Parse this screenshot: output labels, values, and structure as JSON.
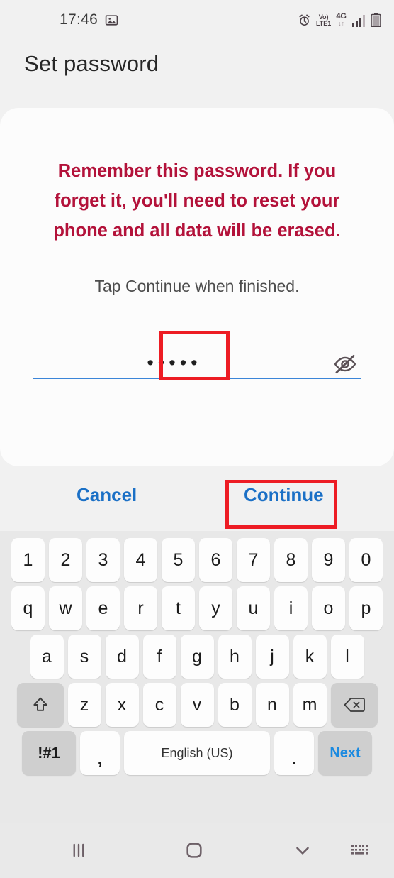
{
  "status_bar": {
    "time": "17:46",
    "left_icons": [
      "image-icon"
    ],
    "right_icons": [
      "alarm-icon",
      "volte-icon",
      "network-4g-icon",
      "signal-bars-icon",
      "battery-icon"
    ],
    "volte_top": "Vo)",
    "volte_bottom": "LTE1",
    "network_label": "4G",
    "network_arrows": "↓↑"
  },
  "header": {
    "title": "Set password"
  },
  "card": {
    "warning": "Remember this password. If you forget it, you'll need to reset your phone and all data will be erased.",
    "hint": "Tap Continue when finished.",
    "password_field": {
      "value": "•••••",
      "character_count": 5,
      "masked": true,
      "toggle_icon": "eye-slash-icon"
    }
  },
  "actions": {
    "cancel_label": "Cancel",
    "continue_label": "Continue"
  },
  "annotations": [
    {
      "name": "password-field-highlight",
      "color": "#ed1c24"
    },
    {
      "name": "continue-button-highlight",
      "color": "#ed1c24"
    }
  ],
  "keyboard": {
    "language": "English (US)",
    "row_numbers": [
      "1",
      "2",
      "3",
      "4",
      "5",
      "6",
      "7",
      "8",
      "9",
      "0"
    ],
    "row_top": [
      "q",
      "w",
      "e",
      "r",
      "t",
      "y",
      "u",
      "i",
      "o",
      "p"
    ],
    "row_home": [
      "a",
      "s",
      "d",
      "f",
      "g",
      "h",
      "j",
      "k",
      "l"
    ],
    "row_bottom": [
      "z",
      "x",
      "c",
      "v",
      "b",
      "n",
      "m"
    ],
    "shift_icon": "shift-arrow-icon",
    "backspace_icon": "backspace-icon",
    "symbols_label": "!#1",
    "comma_label": ",",
    "period_label": ".",
    "next_label": "Next"
  },
  "nav_bar": {
    "recents_icon": "recents-icon",
    "home_icon": "home-icon",
    "back_icon": "chevron-down-icon",
    "keyboard_switch_icon": "keyboard-switch-icon"
  },
  "colors": {
    "warning_red": "#b3123a",
    "action_blue": "#1b70c6",
    "underline_blue": "#3b85d8",
    "annotation_red": "#ed1c24",
    "page_bg": "#f1f1f1",
    "card_bg": "#fcfcfc",
    "keyboard_bg": "#e8e8e8"
  }
}
